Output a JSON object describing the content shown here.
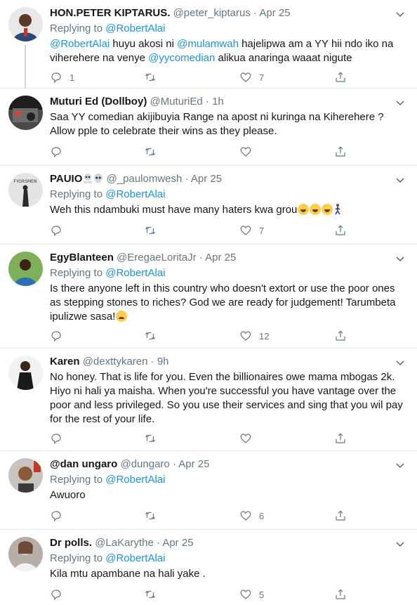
{
  "tweets": [
    {
      "name": "HON.PETER KIPTARUS.",
      "handle": "@peter_kiptarus",
      "sep": "·",
      "time": "Apr 25",
      "replying_prefix": "",
      "replying_to": "",
      "text_parts": [
        "@RobertAlai",
        "  huyu akosi ni ",
        "@mulamwah",
        " hajelipwa am a YY hii ndo iko na viherehere na venye ",
        "@yycomedian",
        " alikua anaringa waaat nigute"
      ],
      "replies": "1",
      "retweets": "",
      "likes": "7",
      "avatar_color": "#2b4a7a"
    },
    {
      "name": "Muturi Ed (Dollboy)",
      "handle": "@MuturiEd",
      "sep": "·",
      "time": "1h",
      "text": "Saa YY comedian akijibuyia Range na apost ni kuringa na Kiherehere ? Allow pple to celebrate their wins as they please.",
      "replies": "",
      "retweets": "",
      "likes": "",
      "avatar_color": "#3a3a3a"
    },
    {
      "name": "PAUIO",
      "handle": "@_paulomwesh",
      "sep": "·",
      "time": "Apr 25",
      "replying_prefix": "Replying to",
      "replying_to": "@RobertAlai",
      "text": "Weh this ndambuki must have many haters kwa grou",
      "replies": "",
      "retweets": "",
      "likes": "7",
      "avatar_text": "FYORSMEN",
      "avatar_color": "#d9d9d9"
    },
    {
      "name": "EgyBlanteen",
      "handle": "@EregaeLoritaJr",
      "sep": "·",
      "time": "Apr 25",
      "replying_prefix": "Replying to",
      "replying_to": "@RobertAlai",
      "text": "Is there anyone left in this country  who doesn't extort or use the poor ones as stepping stones to riches? God we are ready for judgement! Tarumbeta ipulizwe sasa!",
      "replies": "",
      "retweets": "",
      "likes": "12",
      "avatar_color": "#2e6fb3"
    },
    {
      "name": "Karen",
      "handle": "@dexttykaren",
      "sep": "·",
      "time": "9h",
      "text": "No honey. That is life for you. Even the billionaires owe mama mbogas 2k. Hiyo ni hali ya maisha. When you're successful you have vantage over the poor and less privileged. So you use their services and sing that you wil pay for the rest of your life.",
      "replies": "",
      "retweets": "",
      "likes": "",
      "avatar_color": "#2a2a2a"
    },
    {
      "name": "@dan ungaro",
      "handle": "@dungaro",
      "sep": "·",
      "time": "Apr 25",
      "replying_prefix": "Replying to",
      "replying_to": "@RobertAlai",
      "text": "Awuoro",
      "replies": "",
      "retweets": "",
      "likes": "6",
      "avatar_color": "#b57a54"
    },
    {
      "name": "Dr polls.",
      "handle": "@LaKarythe",
      "sep": "·",
      "time": "Apr 25",
      "replying_prefix": "Replying to",
      "replying_to": "@RobertAlai",
      "text": "Kila mtu apambane na hali yake .",
      "replies": "",
      "retweets": "",
      "likes": "5",
      "avatar_color": "#9a8d86"
    }
  ],
  "icons": {
    "reply": "reply-icon",
    "retweet": "retweet-icon",
    "like": "heart-icon",
    "share": "share-icon",
    "more": "chevron-down-icon"
  },
  "colors": {
    "link": "#1b95e0",
    "muted": "#657786",
    "divider": "#e6ecf0"
  }
}
